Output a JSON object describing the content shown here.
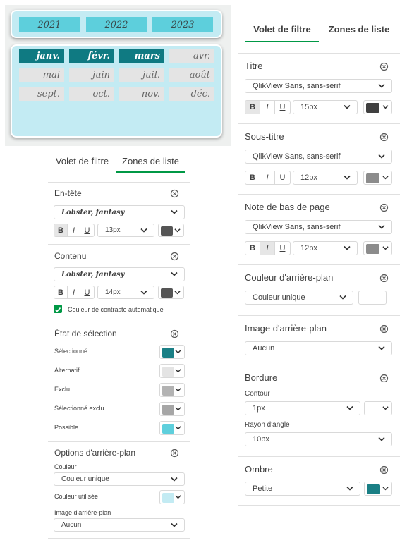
{
  "preview": {
    "years": [
      "2021",
      "2022",
      "2023"
    ],
    "months": [
      {
        "label": "janv.",
        "selected": true
      },
      {
        "label": "févr.",
        "selected": true
      },
      {
        "label": "mars",
        "selected": true
      },
      {
        "label": "avr.",
        "selected": false
      },
      {
        "label": "mai",
        "selected": false
      },
      {
        "label": "juin",
        "selected": false
      },
      {
        "label": "juil.",
        "selected": false
      },
      {
        "label": "août",
        "selected": false
      },
      {
        "label": "sept.",
        "selected": false
      },
      {
        "label": "oct.",
        "selected": false
      },
      {
        "label": "nov.",
        "selected": false
      },
      {
        "label": "déc.",
        "selected": false
      }
    ]
  },
  "left_panel": {
    "tabs": [
      "Volet de filtre",
      "Zones de liste"
    ],
    "active_tab": "Zones de liste",
    "header": {
      "title": "En-tête",
      "font": "Lobster, fantasy",
      "format": [
        "B",
        "I",
        "U"
      ],
      "size": "13px",
      "color": "#555555"
    },
    "content": {
      "title": "Contenu",
      "font": "Lobster, fantasy",
      "format": [
        "B",
        "I",
        "U"
      ],
      "size": "14px",
      "color": "#555555",
      "auto_contrast_label": "Couleur de contraste automatique",
      "auto_contrast_checked": true
    },
    "selection_state": {
      "title": "État de sélection",
      "items": [
        {
          "label": "Sélectionné",
          "color": "#1a7f85"
        },
        {
          "label": "Alternatif",
          "color": "#e4e4e4"
        },
        {
          "label": "Exclu",
          "color": "#b3b3b3"
        },
        {
          "label": "Sélectionné exclu",
          "color": "#a6a6a6"
        },
        {
          "label": "Possible",
          "color": "#5ecfdc"
        }
      ]
    },
    "background_options": {
      "title": "Options d'arrière-plan",
      "color_label": "Couleur",
      "color_mode": "Couleur unique",
      "used_color_label": "Couleur utilisée",
      "used_color": "#c3ebf3",
      "image_label": "Image d'arrière-plan",
      "image_value": "Aucun"
    }
  },
  "right_panel": {
    "tabs": [
      "Volet de filtre",
      "Zones de liste"
    ],
    "active_tab": "Volet de filtre",
    "title_section": {
      "title": "Titre",
      "font": "QlikView Sans, sans-serif",
      "format": [
        "B",
        "I",
        "U"
      ],
      "active_format": "B",
      "size": "15px",
      "color": "#404040"
    },
    "subtitle_section": {
      "title": "Sous-titre",
      "font": "QlikView Sans, sans-serif",
      "format": [
        "B",
        "I",
        "U"
      ],
      "size": "12px",
      "color": "#8c8c8c"
    },
    "footnote_section": {
      "title": "Note de bas de page",
      "font": "QlikView Sans, sans-serif",
      "format": [
        "B",
        "I",
        "U"
      ],
      "active_format": "I",
      "size": "12px",
      "color": "#8c8c8c"
    },
    "background_color": {
      "title": "Couleur d'arrière-plan",
      "mode": "Couleur unique"
    },
    "background_image": {
      "title": "Image d'arrière-plan",
      "value": "Aucun"
    },
    "border": {
      "title": "Bordure",
      "outline_label": "Contour",
      "outline_value": "1px",
      "radius_label": "Rayon d'angle",
      "radius_value": "10px"
    },
    "shadow": {
      "title": "Ombre",
      "value": "Petite",
      "color": "#1a7f85"
    }
  },
  "colors": {
    "accent": "#009845",
    "checkbox": "#009845"
  }
}
